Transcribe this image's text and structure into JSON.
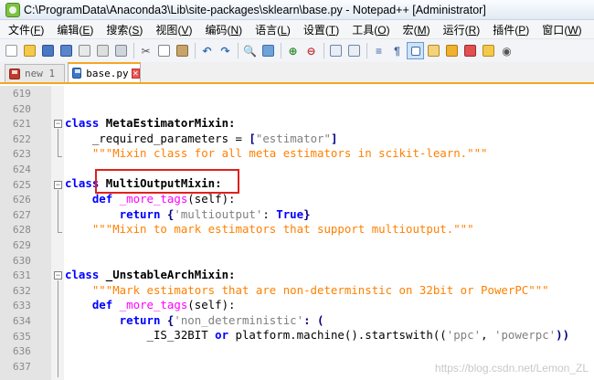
{
  "window": {
    "title": "C:\\ProgramData\\Anaconda3\\Lib\\site-packages\\sklearn\\base.py - Notepad++ [Administrator]"
  },
  "menubar": [
    {
      "label": "文件",
      "key": "F"
    },
    {
      "label": "编辑",
      "key": "E"
    },
    {
      "label": "搜索",
      "key": "S"
    },
    {
      "label": "视图",
      "key": "V"
    },
    {
      "label": "编码",
      "key": "N"
    },
    {
      "label": "语言",
      "key": "L"
    },
    {
      "label": "设置",
      "key": "T"
    },
    {
      "label": "工具",
      "key": "O"
    },
    {
      "label": "宏",
      "key": "M"
    },
    {
      "label": "运行",
      "key": "R"
    },
    {
      "label": "插件",
      "key": "P"
    },
    {
      "label": "窗口",
      "key": "W"
    },
    {
      "label": "?",
      "key": ""
    }
  ],
  "tabs": [
    {
      "label": "new 1",
      "active": false
    },
    {
      "label": "base.py",
      "active": true
    }
  ],
  "editor": {
    "line_numbers": [
      "619",
      "620",
      "621",
      "622",
      "623",
      "624",
      "625",
      "626",
      "627",
      "628",
      "629",
      "630",
      "631",
      "632",
      "633",
      "634",
      "635",
      "636",
      "637"
    ],
    "code": {
      "l621_kw": "class",
      "l621_name": " MetaEstimatorMixin:",
      "l622_a": "    _required_parameters = ",
      "l622_b": "[",
      "l622_c": "\"estimator\"",
      "l622_d": "]",
      "l623": "    \"\"\"Mixin class for all meta estimators in scikit-learn.\"\"\"",
      "l625_kw": "class",
      "l625_name": " MultiOutputMixin:",
      "l626_kw": "    def",
      "l626_fn": " _more_tags",
      "l626_rest": "(self):",
      "l627_kw": "        return",
      "l627_a": " {",
      "l627_str": "'multioutput'",
      "l627_b": ": ",
      "l627_true": "True",
      "l627_c": "}",
      "l628": "    \"\"\"Mixin to mark estimators that support multioutput.\"\"\"",
      "l631_kw": "class",
      "l631_name": " _UnstableArchMixin:",
      "l632": "    \"\"\"Mark estimators that are non-determinstic on 32bit or PowerPC\"\"\"",
      "l633_kw": "    def",
      "l633_fn": " _more_tags",
      "l633_rest": "(self):",
      "l634_kw": "        return",
      "l634_a": " {",
      "l634_str": "'non_deterministic'",
      "l634_b": ": (",
      "l635_a": "            _IS_32BIT ",
      "l635_or": "or",
      "l635_b": " platform.machine().startswith((",
      "l635_s1": "'ppc'",
      "l635_c": ", ",
      "l635_s2": "'powerpc'",
      "l635_d": "))"
    }
  },
  "watermark": "https://blog.csdn.net/Lemon_ZL"
}
